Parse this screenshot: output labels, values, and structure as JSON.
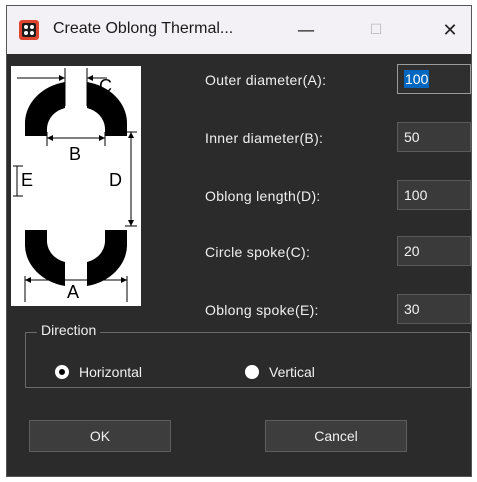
{
  "window": {
    "title": "Create Oblong Thermal...",
    "app_icon": "app-icon",
    "minimize_glyph": "—",
    "maximize_glyph": "☐",
    "close_glyph": "✕"
  },
  "diagram_labels": {
    "a": "A",
    "b": "B",
    "c": "C",
    "d": "D",
    "e": "E"
  },
  "fields": [
    {
      "label": "Outer diameter(A):",
      "value": "100"
    },
    {
      "label": "Inner diameter(B):",
      "value": "50"
    },
    {
      "label": "Oblong length(D):",
      "value": "100"
    },
    {
      "label": "Circle spoke(C):",
      "value": "20"
    },
    {
      "label": "Oblong spoke(E):",
      "value": "30"
    }
  ],
  "direction": {
    "title": "Direction",
    "options": [
      {
        "label": "Horizontal",
        "checked": true
      },
      {
        "label": "Vertical",
        "checked": false
      }
    ]
  },
  "buttons": {
    "ok": "OK",
    "cancel": "Cancel"
  }
}
